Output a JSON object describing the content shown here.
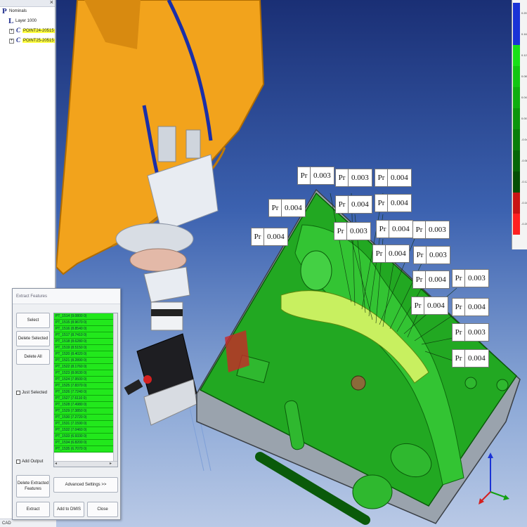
{
  "tree": {
    "title_close": "×",
    "root_glyph": "P",
    "root_label": "Nominals",
    "layer_glyph": "L",
    "layer_label": "Layer 1000",
    "items": [
      {
        "toggle": "+",
        "glyph": "C",
        "label": "POINT24-20515"
      },
      {
        "toggle": "+",
        "glyph": "C",
        "label": "POINT25-20515"
      }
    ],
    "bottom_label": "CAD"
  },
  "dialog": {
    "title": "Extract Features",
    "select_label": "Select",
    "delete_selected_label": "Delete Selected",
    "delete_all_label": "Delete All",
    "just_selected_label": "Just Selected",
    "add_output_label": "Add Output",
    "delete_extracted_label": "Delete Extracted Features",
    "advanced_label": "Advanced Settings >>",
    "extract_label": "Extract",
    "add_to_dmis_label": "Add to DMIS",
    "close_label": "Close",
    "scroll_left": "◂",
    "scroll_right": "▸",
    "features": [
      "PT_1514 (9.0800 0)",
      "PT_1515 (8.9670 0)",
      "PT_1516 (8.8540 0)",
      "PT_1517 (8.7410 0)",
      "PT_1518 (8.6280 0)",
      "PT_1519 (8.5150 0)",
      "PT_1520 (8.4020 0)",
      "PT_1521 (8.2890 0)",
      "PT_1522 (8.1760 0)",
      "PT_1523 (8.0630 0)",
      "PT_1524 (7.9500 0)",
      "PT_1525 (7.8370 0)",
      "PT_1526 (7.7240 0)",
      "PT_1527 (7.6110 0)",
      "PT_1528 (7.4980 0)",
      "PT_1529 (7.3850 0)",
      "PT_1530 (7.2720 0)",
      "PT_1531 (7.1590 0)",
      "PT_1532 (7.0460 0)",
      "PT_1533 (6.9330 0)",
      "PT_1534 (6.8200 0)",
      "PT_1535 (6.7070 0)"
    ]
  },
  "callouts": {
    "prefix": "Pr",
    "values": [
      "0.003",
      "0.003",
      "0.004",
      "0.004",
      "0.004",
      "0.004",
      "0.003",
      "0.004",
      "0.004",
      "0.003",
      "0.004",
      "0.003",
      "0.004",
      "0.003",
      "0.004",
      "0.004",
      "0.003",
      "0.004"
    ]
  },
  "color_scale": {
    "ticks": [
      "0.20",
      "0.16",
      "0.12",
      "0.08",
      "0.04",
      "0.00",
      "-0.04",
      "-0.08",
      "-0.12",
      "-0.16",
      "-0.20"
    ],
    "colors": [
      "#1a33d6",
      "#1a33d6",
      "#18e018",
      "#12c612",
      "#0fae0f",
      "#0c960c",
      "#097e09",
      "#066606",
      "#044e04",
      "#c81414",
      "#ff2020"
    ]
  },
  "colors": {
    "part_green": "#22b022",
    "robot_orange": "#f0a020"
  }
}
